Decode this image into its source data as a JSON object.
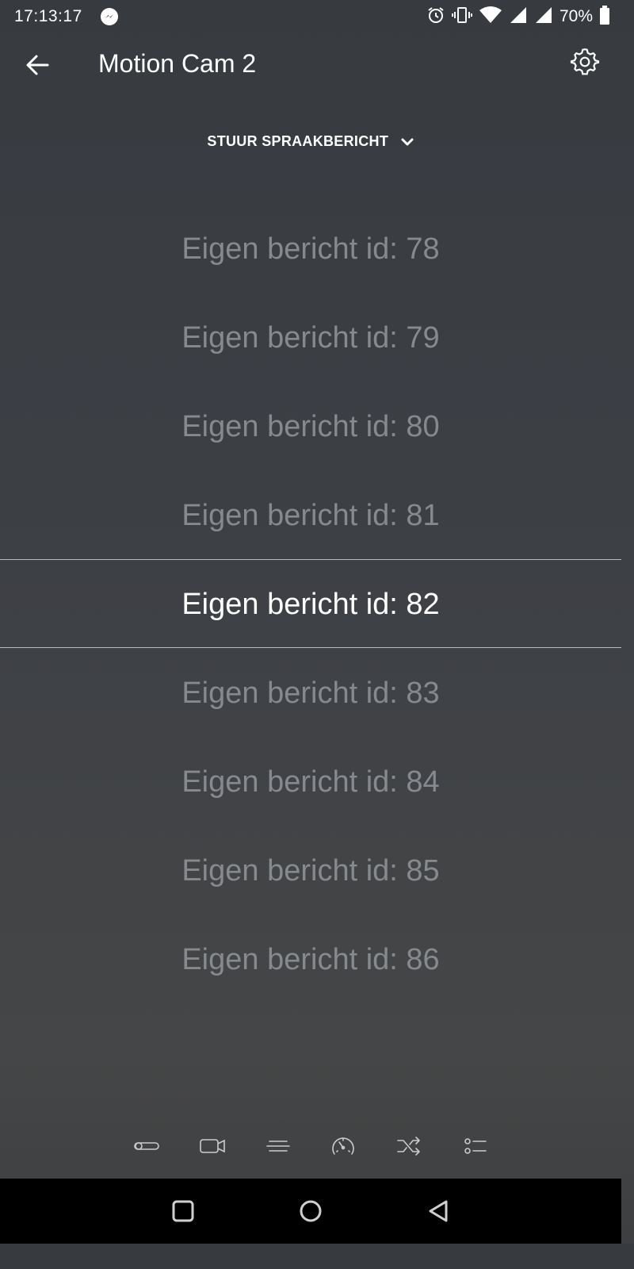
{
  "status_bar": {
    "time": "17:13:17",
    "battery_percent": "70%",
    "icons": [
      "facebook-messenger-icon",
      "alarm-icon",
      "vibrate-icon",
      "wifi-icon",
      "signal-icon",
      "signal-icon",
      "battery-icon"
    ]
  },
  "app_bar": {
    "title": "Motion Cam 2",
    "back_icon": "arrow-left-icon",
    "settings_icon": "gear-icon"
  },
  "dropdown": {
    "label": "STUUR SPRAAKBERICHT",
    "icon": "chevron-down-icon"
  },
  "picker": {
    "items": [
      "Eigen bericht id: 78",
      "Eigen bericht id: 79",
      "Eigen bericht id: 80",
      "Eigen bericht id: 81",
      "Eigen bericht id: 82",
      "Eigen bericht id: 83",
      "Eigen bericht id: 84",
      "Eigen bericht id: 85",
      "Eigen bericht id: 86"
    ],
    "selected": "Eigen bericht id: 82",
    "colors": {
      "selected": "#ffffff",
      "unselected": "#86898d"
    }
  },
  "bottom_nav": {
    "icons": [
      "toggle-icon",
      "video-camera-icon",
      "lines-icon",
      "speedometer-icon",
      "shuffle-icon",
      "list-icon"
    ]
  },
  "system_nav": {
    "icons": [
      "recent-apps-icon",
      "home-icon",
      "back-triangle-icon"
    ]
  }
}
